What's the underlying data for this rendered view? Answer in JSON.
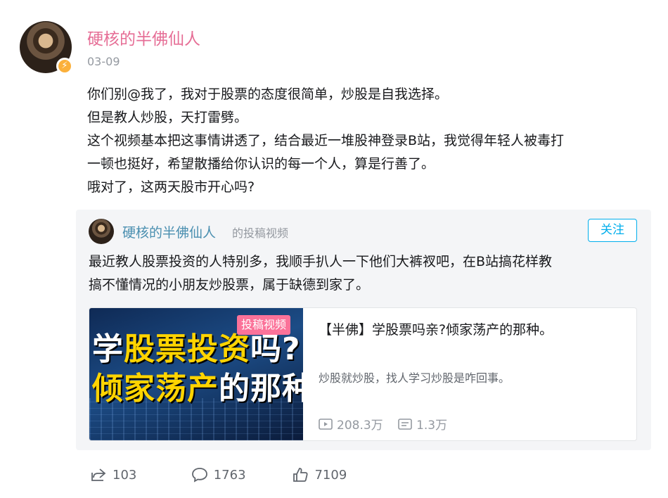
{
  "post": {
    "author": "硬核的半佛仙人",
    "date": "03-09",
    "lines": [
      "你们别@我了，我对于股票的态度很简单，炒股是自我选择。",
      "但是教人炒股，天打雷劈。",
      "这个视频基本把这事情讲透了，结合最近一堆股神登录B站，我觉得年轻人被毒打",
      "一顿也挺好，希望散播给你认识的每一个人，算是行善了。",
      "哦对了，这两天股市开心吗?"
    ]
  },
  "repost": {
    "author": "硬核的半佛仙人",
    "action": "的投稿视频",
    "follow_label": "关注",
    "lines": [
      "最近教人股票投资的人特别多，我顺手扒人一下他们大裤衩吧，在B站搞花样教",
      "搞不懂情况的小朋友炒股票，属于缺德到家了。"
    ],
    "video": {
      "thumb_line1_a": "学",
      "thumb_line1_b": "股票投资",
      "thumb_line1_c": "吗?",
      "thumb_line2_a": "倾家荡产",
      "thumb_line2_b": "的那种",
      "tag": "投稿视频",
      "title": "【半佛】学股票吗亲?倾家荡产的那种。",
      "desc": "炒股就炒股，找人学习炒股是咋回事。",
      "plays": "208.3万",
      "danmaku": "1.3万"
    }
  },
  "actions": {
    "share": "103",
    "comment": "1763",
    "like": "7109"
  },
  "colors": {
    "author_pink": "#e66e96",
    "link_blue": "#00aeec",
    "tag_pink": "#fb7299"
  }
}
